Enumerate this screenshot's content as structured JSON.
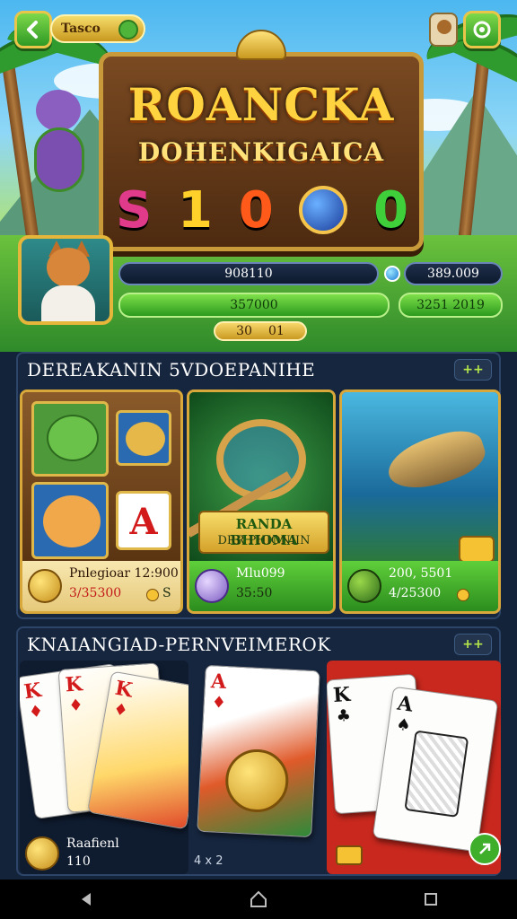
{
  "header": {
    "badge_text": "Tasco",
    "logo_line1": "ROANCKA",
    "logo_line2": "DOHENKIGAICA",
    "slot_symbols": [
      "S",
      "1",
      "0",
      "0"
    ]
  },
  "stats": {
    "bar1": "908110",
    "bar1_right": "389.009",
    "bar2": "357000",
    "bar2_right": "3251 2019",
    "bar3_left": "30",
    "bar3_right": "01"
  },
  "section1": {
    "title": "DEREAKANIN 5VDOEPANIHE",
    "more_label": "++",
    "cards": [
      {
        "name": "Pnlegioar 12:900",
        "sub": "3/35300",
        "sub_suffix": "S"
      },
      {
        "banner_line1": "RANDA BHIOMA",
        "banner_line2": "DRR PHIONIIN",
        "name": "Mlu099",
        "sub": "35:50"
      },
      {
        "name": "200, 5501",
        "sub": "4/25300"
      }
    ]
  },
  "section2": {
    "title": "KNAIANGIAD-PERNVEIMEROK",
    "more_label": "++",
    "footer_name": "Raafienl",
    "footer_sub": "110",
    "footer_mid": "4 x 2",
    "cards_left": [
      {
        "rank": "K",
        "suit": "♦"
      },
      {
        "rank": "K",
        "suit": "♦"
      },
      {
        "rank": "K",
        "suit": "♦"
      }
    ],
    "card_center": {
      "rank": "A",
      "suit": "♦"
    },
    "cards_right": [
      {
        "rank": "K",
        "suit": "♣"
      },
      {
        "rank": "A",
        "suit": "♠"
      }
    ]
  },
  "colors": {
    "accent_green": "#5fcf3a",
    "accent_gold": "#d8a93a",
    "panel_bg": "#16263f"
  }
}
